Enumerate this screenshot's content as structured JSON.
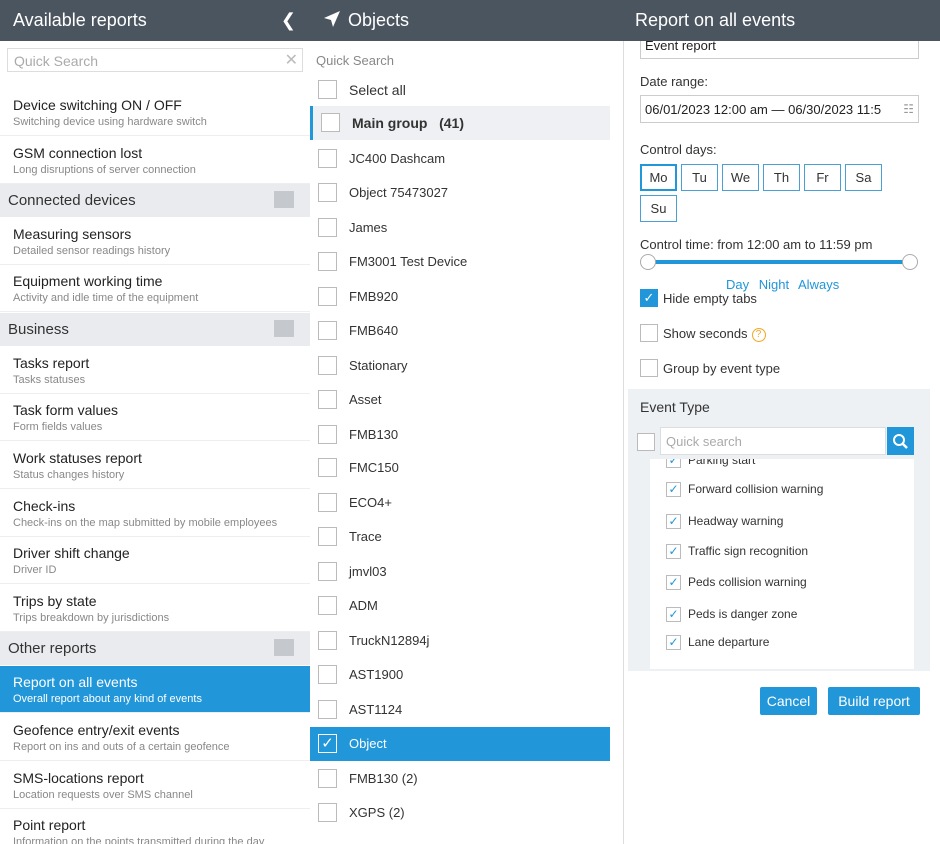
{
  "left": {
    "title": "Available reports",
    "search_placeholder": "Quick Search",
    "items": [
      {
        "t": "Device switching ON / OFF",
        "s": "Switching device using hardware switch"
      },
      {
        "t": "GSM connection lost",
        "s": "Long disruptions of server connection"
      },
      {
        "t": "Measuring sensors",
        "s": "Detailed sensor readings history"
      },
      {
        "t": "Equipment working time",
        "s": "Activity and idle time of the equipment"
      },
      {
        "t": "Tasks report",
        "s": "Tasks statuses"
      },
      {
        "t": "Task form values",
        "s": "Form fields values"
      },
      {
        "t": "Work statuses report",
        "s": "Status changes history"
      },
      {
        "t": "Check-ins",
        "s": "Check-ins on the map submitted by mobile employees"
      },
      {
        "t": "Driver shift change",
        "s": "Driver ID"
      },
      {
        "t": "Trips by state",
        "s": "Trips breakdown by jurisdictions"
      },
      {
        "t": "Report on all events",
        "s": "Overall report about any kind of events"
      },
      {
        "t": "Geofence entry/exit events",
        "s": "Report on ins and outs of a certain geofence"
      },
      {
        "t": "SMS-locations report",
        "s": "Location requests over SMS channel"
      },
      {
        "t": "Point report",
        "s": "Information on the points transmitted during the day"
      }
    ],
    "groups": [
      "Connected devices",
      "Business",
      "Other reports"
    ]
  },
  "mid": {
    "title": "Objects",
    "search_placeholder": "Quick Search",
    "select_all": "Select all",
    "main_group": "Main group",
    "main_count": "(41)",
    "objects": [
      "JC400 Dashcam",
      "Object 75473027",
      "James",
      "FM3001 Test Device",
      "FMB920",
      "FMB640",
      "Stationary",
      "Asset",
      "FMB130",
      "FMC150",
      "ECO4+",
      "Trace",
      "jmvl03",
      "ADM",
      "TruckN12894j",
      "AST1900",
      "AST1124",
      "Object",
      "FMB130 (2)",
      "XGPS (2)"
    ]
  },
  "right": {
    "title": "Report on all events",
    "report_type": "Event report",
    "date_label": "Date range:",
    "date_value": "06/01/2023 12:00 am — 06/30/2023 11:5",
    "control_days_label": "Control days:",
    "days": [
      "Mo",
      "Tu",
      "We",
      "Th",
      "Fr",
      "Sa",
      "Su"
    ],
    "control_time": "Control time: from 12:00 am to 11:59 pm",
    "time_links": [
      "Day",
      "Night",
      "Always"
    ],
    "hide_empty": "Hide empty tabs",
    "show_seconds": "Show seconds",
    "group_by": "Group by event type",
    "event_type": "Event Type",
    "event_search": "Quick search",
    "events": [
      "Parking start",
      "Forward collision warning",
      "Headway warning",
      "Traffic sign recognition",
      "Peds collision warning",
      "Peds is danger zone",
      "Lane departure"
    ],
    "cancel": "Cancel",
    "build": "Build report"
  }
}
